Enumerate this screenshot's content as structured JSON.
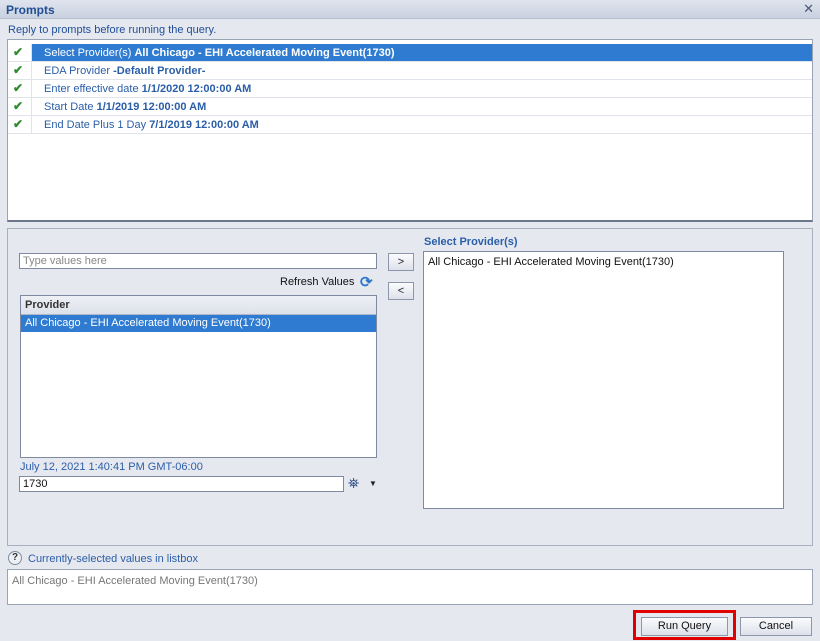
{
  "window": {
    "title": "Prompts",
    "close_glyph": "✕"
  },
  "instruction": "Reply to prompts before running the query.",
  "prompts": [
    {
      "name": "Select Provider(s)",
      "value": "All Chicago - EHI Accelerated Moving Event(1730)",
      "selected": true,
      "icon": "check-icon"
    },
    {
      "name": "EDA Provider",
      "value": "-Default Provider-",
      "selected": false,
      "icon": "check-icon"
    },
    {
      "name": "Enter effective date",
      "value": "1/1/2020 12:00:00 AM",
      "selected": false,
      "icon": "check-icon"
    },
    {
      "name": "Start Date",
      "value": "1/1/2019 12:00:00 AM",
      "selected": false,
      "icon": "check-icon"
    },
    {
      "name": "End Date Plus 1 Day",
      "value": "7/1/2019 12:00:00 AM",
      "selected": false,
      "icon": "check-icon"
    }
  ],
  "detail": {
    "search_placeholder": "Type values here",
    "refresh_label": "Refresh Values",
    "add_glyph": ">",
    "remove_glyph": "<",
    "list_header": "Provider",
    "list_items": [
      "All Chicago - EHI Accelerated Moving Event(1730)"
    ],
    "timestamp": "July 12, 2021 1:40:41 PM GMT-06:00",
    "value_input": "1730",
    "selected_label": "Select Provider(s)",
    "selected_items": [
      "All Chicago - EHI Accelerated Moving Event(1730)"
    ]
  },
  "current": {
    "label": "Currently-selected values in listbox",
    "value": "All Chicago - EHI Accelerated Moving Event(1730)",
    "help_glyph": "?"
  },
  "buttons": {
    "run_query": "Run Query",
    "cancel": "Cancel"
  },
  "colors": {
    "accent": "#2e7bd1",
    "label_blue": "#2a5ea8",
    "highlight": "#e00000",
    "check": "#2f8d2f"
  }
}
